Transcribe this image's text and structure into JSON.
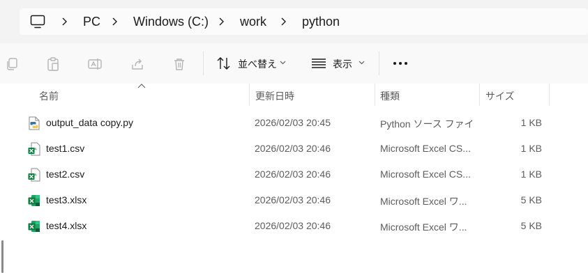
{
  "address": {
    "crumbs": [
      "PC",
      "Windows (C:)",
      "work",
      "python"
    ]
  },
  "toolbar": {
    "sort_label": "並べ替え",
    "view_label": "表示"
  },
  "columns": {
    "name": "名前",
    "modified": "更新日時",
    "type": "種類",
    "size": "サイズ"
  },
  "files": [
    {
      "name": "output_data copy.py",
      "modified": "2026/02/03 20:45",
      "type": "Python ソース ファイル",
      "size": "1 KB",
      "icon": "python-file-icon"
    },
    {
      "name": "test1.csv",
      "modified": "2026/02/03 20:46",
      "type": "Microsoft Excel CS...",
      "size": "1 KB",
      "icon": "excel-csv-icon"
    },
    {
      "name": "test2.csv",
      "modified": "2026/02/03 20:46",
      "type": "Microsoft Excel CS...",
      "size": "1 KB",
      "icon": "excel-csv-icon"
    },
    {
      "name": "test3.xlsx",
      "modified": "2026/02/03 20:46",
      "type": "Microsoft Excel ワ...",
      "size": "5 KB",
      "icon": "excel-workbook-icon"
    },
    {
      "name": "test4.xlsx",
      "modified": "2026/02/03 20:46",
      "type": "Microsoft Excel ワ...",
      "size": "5 KB",
      "icon": "excel-workbook-icon"
    }
  ],
  "colors": {
    "excel_green": "#107c41",
    "python_blue": "#3572a5",
    "python_yellow": "#f7c948"
  }
}
